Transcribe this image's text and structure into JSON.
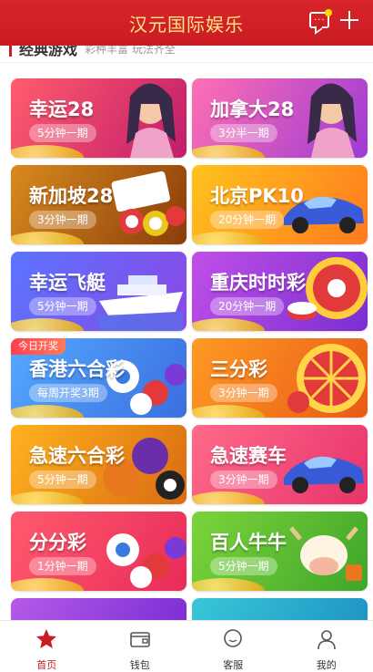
{
  "header": {
    "title": "汉元国际娱乐"
  },
  "section": {
    "title": "经典游戏",
    "subtitle": "彩种丰富 玩法齐全"
  },
  "games": [
    {
      "name": "幸运28",
      "period": "5分钟一期",
      "bg_from": "#ff5c6c",
      "bg_to": "#c11d6b",
      "art": "character"
    },
    {
      "name": "加拿大28",
      "period": "3分半一期",
      "bg_from": "#ff6fb2",
      "bg_to": "#9d3bd4",
      "art": "character"
    },
    {
      "name": "新加坡28",
      "period": "3分钟一期",
      "bg_from": "#d98a1f",
      "bg_to": "#8a3d09",
      "art": "bingo"
    },
    {
      "name": "北京PK10",
      "period": "20分钟一期",
      "bg_from": "#ffc21d",
      "bg_to": "#ff7a1f",
      "art": "racecar"
    },
    {
      "name": "幸运飞艇",
      "period": "5分钟一期",
      "bg_from": "#5b74ff",
      "bg_to": "#8a48e6",
      "art": "ship"
    },
    {
      "name": "重庆时时彩",
      "period": "20分钟一期",
      "bg_from": "#c14fe8",
      "bg_to": "#7a2fd1",
      "art": "roulette"
    },
    {
      "name": "香港六合彩",
      "period": "每周开奖3期",
      "tag": "今日开奖",
      "bg_from": "#55a8ff",
      "bg_to": "#3a6fe0",
      "art": "balls"
    },
    {
      "name": "三分彩",
      "period": "3分钟一期",
      "bg_from": "#ff9a24",
      "bg_to": "#e85a16",
      "art": "wheel"
    },
    {
      "name": "急速六合彩",
      "period": "5分钟一期",
      "bg_from": "#ffb21f",
      "bg_to": "#d96b10",
      "art": "billiards"
    },
    {
      "name": "急速赛车",
      "period": "3分钟一期",
      "bg_from": "#ff6a8a",
      "bg_to": "#e8336b",
      "art": "racecar"
    },
    {
      "name": "分分彩",
      "period": "1分钟一期",
      "bg_from": "#ff5a6e",
      "bg_to": "#e82c58",
      "art": "balls"
    },
    {
      "name": "百人牛牛",
      "period": "5分钟一期",
      "bg_from": "#7cd43a",
      "bg_to": "#3fa52b",
      "art": "cow"
    },
    {
      "name": "",
      "period": "",
      "bg_from": "#b45ae8",
      "bg_to": "#7c2fd4",
      "art": "none"
    },
    {
      "name": "",
      "period": "",
      "bg_from": "#39c7d8",
      "bg_to": "#1e95c4",
      "art": "none"
    }
  ],
  "nav": [
    {
      "label": "首页",
      "icon": "star-icon",
      "active": true
    },
    {
      "label": "钱包",
      "icon": "wallet-icon",
      "active": false
    },
    {
      "label": "客服",
      "icon": "chat-bubble-icon",
      "active": false
    },
    {
      "label": "我的",
      "icon": "user-icon",
      "active": false
    }
  ],
  "colors": {
    "brand": "#c91c22",
    "title_gold": "#ffe58a"
  }
}
